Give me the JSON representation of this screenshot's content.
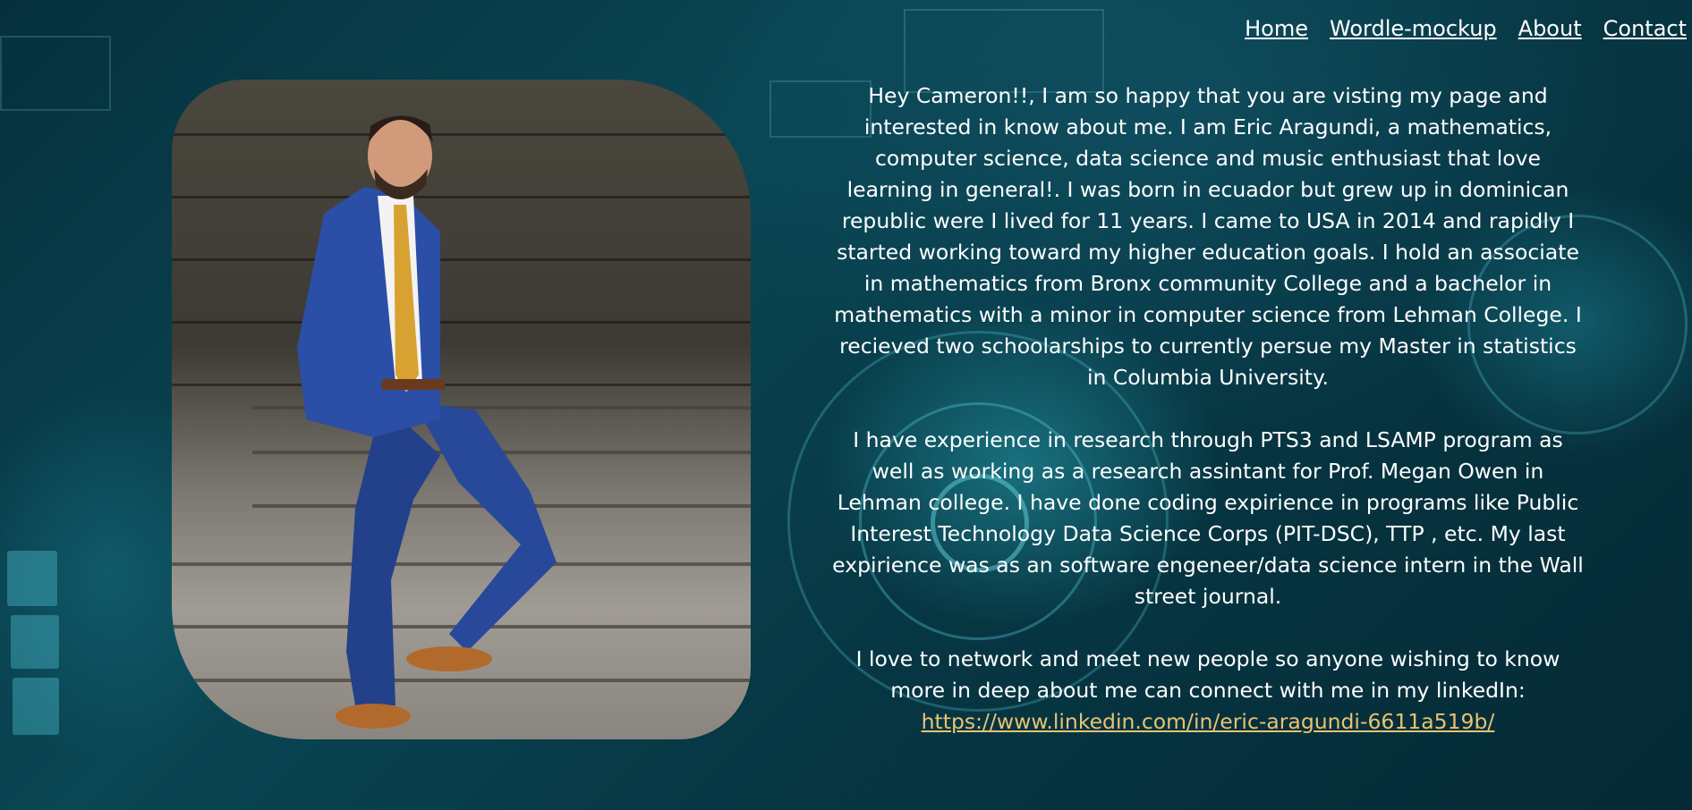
{
  "nav": {
    "items": [
      {
        "label": "Home"
      },
      {
        "label": "Wordle-mockup"
      },
      {
        "label": "About"
      },
      {
        "label": "Contact"
      }
    ]
  },
  "bio": {
    "paragraph1": "Hey Cameron!!, I am so happy that you are visting my page and interested in know about me. I am Eric Aragundi, a mathematics, computer science, data science and music enthusiast that love learning in general!. I was born in ecuador but grew up in dominican republic were I lived for 11 years. I came to USA in 2014 and rapidly I started working toward my higher education goals. I hold an associate in mathematics from Bronx community College and a bachelor in mathematics with a minor in computer science from Lehman College. I recieved two schoolarships to currently persue my Master in statistics in Columbia University.",
    "paragraph2": "I have experience in research through PTS3 and LSAMP program as well as working as a research assintant for Prof. Megan Owen in Lehman college. I have done coding expirience in programs like Public Interest Technology Data Science Corps (PIT-DSC), TTP , etc. My last expirience was as an software engeneer/data science intern in the Wall street journal.",
    "paragraph3": "I love to network and meet new people so anyone wishing to know more in deep about me can connect with me in my linkedIn:",
    "linkedin_url": "https://www.linkedin.com/in/eric-aragundi-6611a519b/"
  },
  "colors": {
    "background": "#073744",
    "text": "#ffffff",
    "link_accent": "#e6c372"
  }
}
